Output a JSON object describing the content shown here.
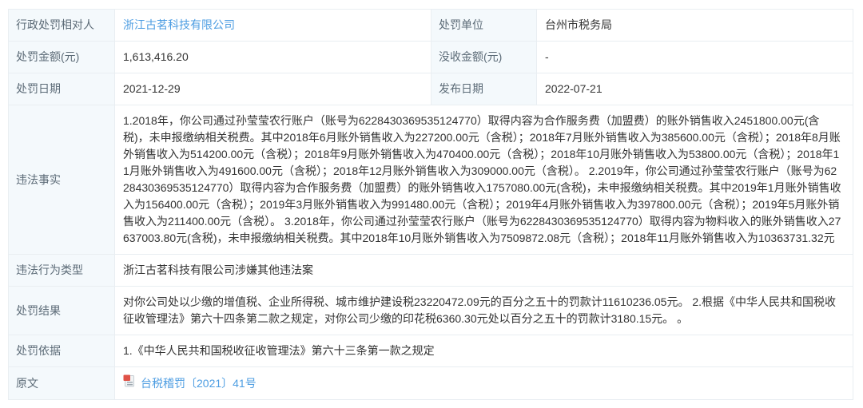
{
  "table": {
    "subject": {
      "label": "行政处罚相对人",
      "value": "浙江古茗科技有限公司"
    },
    "unit": {
      "label": "处罚单位",
      "value": "台州市税务局"
    },
    "amount": {
      "label": "处罚金额(元)",
      "value": "1,613,416.20"
    },
    "confiscation": {
      "label": "没收金额(元)",
      "value": "-"
    },
    "penalty_date": {
      "label": "处罚日期",
      "value": "2021-12-29"
    },
    "publish_date": {
      "label": "发布日期",
      "value": "2022-07-21"
    },
    "facts": {
      "label": "违法事实",
      "value": "1.2018年，你公司通过孙莹莹农行账户（账号为6228430369535124770）取得内容为合作服务费（加盟费）的账外销售收入2451800.00元(含税)，未申报缴纳相关税费。其中2018年6月账外销售收入为227200.00元（含税）；2018年7月账外销售收入为385600.00元（含税）；2018年8月账外销售收入为514200.00元（含税）；2018年9月账外销售收入为470400.00元（含税）；2018年10月账外销售收入为53800.00元（含税）；2018年11月账外销售收入为491600.00元（含税）；2018年12月账外销售收入为309000.00元（含税）。 2.2019年，你公司通过孙莹莹农行账户（账号为6228430369535124770）取得内容为合作服务费（加盟费）的账外销售收入1757080.00元(含税)，未申报缴纳相关税费。其中2019年1月账外销售收入为156400.00元（含税）；2019年3月账外销售收入为991480.00元（含税）；2019年4月账外销售收入为397800.00元（含税）；2019年5月账外销售收入为211400.00元（含税）。 3.2018年，你公司通过孙莹莹农行账户（账号为6228430369535124770）取得内容为物料收入的账外销售收入27637003.80元(含税)，未申报缴纳相关税费。其中2018年10月账外销售收入为7509872.08元（含税）；2018年11月账外销售收入为10363731.32元"
    },
    "violation_type": {
      "label": "违法行为类型",
      "value": "浙江古茗科技有限公司涉嫌其他违法案"
    },
    "result": {
      "label": "处罚结果",
      "value": "对你公司处以少缴的增值税、企业所得税、城市维护建设税23220472.09元的百分之五十的罚款计11610236.05元。 2.根据《中华人民共和国税收征收管理法》第六十四条第二款之规定，对你公司少缴的印花税6360.30元处以百分之五十的罚款计3180.15元。 。"
    },
    "basis": {
      "label": "处罚依据",
      "value": "1.《中华人民共和国税收征收管理法》第六十三条第一款之规定"
    },
    "original": {
      "label": "原文",
      "link_text": "台税稽罚〔2021〕41号",
      "icon": "document-icon"
    }
  },
  "colors": {
    "link": "#4d9de2",
    "label_bg": "#f4f9fc",
    "border": "#e9eef2",
    "label_text": "#5c6b77",
    "value_text": "#333333",
    "doc_icon_red": "#e05247"
  }
}
